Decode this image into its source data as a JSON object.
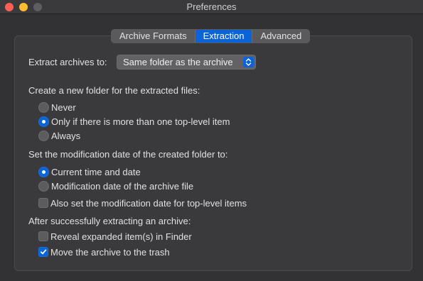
{
  "window": {
    "title": "Preferences"
  },
  "tabs": [
    {
      "label": "Archive Formats",
      "active": false
    },
    {
      "label": "Extraction",
      "active": true
    },
    {
      "label": "Advanced",
      "active": false
    }
  ],
  "extract_to": {
    "label": "Extract archives to:",
    "selected": "Same folder as the archive"
  },
  "new_folder": {
    "heading": "Create a new folder for the extracted files:",
    "options": [
      {
        "label": "Never",
        "selected": false
      },
      {
        "label": "Only if there is more than one top-level item",
        "selected": true
      },
      {
        "label": "Always",
        "selected": false
      }
    ]
  },
  "mod_date": {
    "heading": "Set the modification date of the created folder to:",
    "options": [
      {
        "label": "Current time and date",
        "selected": true
      },
      {
        "label": "Modification date of the archive file",
        "selected": false
      }
    ],
    "also_set": {
      "label": "Also set the modification date for top-level items",
      "checked": false
    }
  },
  "after_extract": {
    "heading": "After successfully extracting an archive:",
    "reveal": {
      "label": "Reveal expanded item(s) in Finder",
      "checked": false
    },
    "trash": {
      "label": "Move the archive to the trash",
      "checked": true
    }
  },
  "colors": {
    "accent": "#0a64d8",
    "close": "#fe5f57",
    "minimize": "#febc2e"
  }
}
